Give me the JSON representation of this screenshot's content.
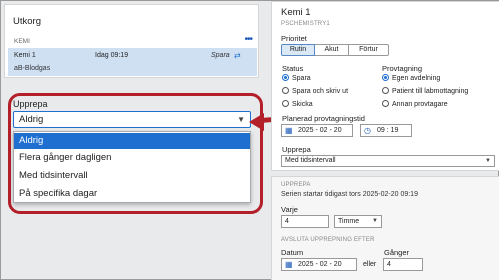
{
  "left": {
    "panel_title": "Utkorg",
    "section_label": "KEMI",
    "more_icon": "more-dots-icon",
    "order": {
      "name": "Kemi 1",
      "time": "Idag 09:19",
      "status": "Spara",
      "sync_icon": "sync-icon",
      "sub": "aB-Blodgas"
    },
    "repeat_label": "Upprepa",
    "repeat_selected": "Aldrig",
    "options": [
      "Aldrig",
      "Flera gånger dagligen",
      "Med tidsintervall",
      "På specifika dagar"
    ]
  },
  "right": {
    "title": "Kemi 1",
    "subtitle": "PSCHEMISTRY1",
    "priority_label": "Prioritet",
    "priority_options": [
      "Rutin",
      "Akut",
      "Förtur"
    ],
    "priority_selected": "Rutin",
    "status_label": "Status",
    "status_options": [
      "Spara",
      "Spara och skriv ut",
      "Skicka"
    ],
    "status_selected": "Spara",
    "sampling_label": "Provtagning",
    "sampling_options": [
      "Egen avdelning",
      "Patient till labmottagning",
      "Annan provtagare"
    ],
    "sampling_selected": "Egen avdelning",
    "planned_label": "Planerad provtagningstid",
    "planned_date": "2025 - 02 - 20",
    "planned_time": "09 : 19",
    "repeat_label": "Upprepa",
    "repeat_value": "Med tidsintervall"
  },
  "repeat_panel": {
    "header": "UPPREPA",
    "series_text": "Serien startar tidigast tors 2025-02-20 09:19",
    "each_label": "Varje",
    "each_value": "4",
    "unit_value": "Timme",
    "end_header": "AVSLUTA UPPREPNING EFTER",
    "date_label": "Datum",
    "date_value": "2025 - 02 - 20",
    "or_text": "eller",
    "times_label": "Gånger",
    "times_value": "4"
  },
  "colors": {
    "accent": "#1e6fd0",
    "highlight_border": "#b3202a",
    "selected_row": "#cfe0f3"
  }
}
